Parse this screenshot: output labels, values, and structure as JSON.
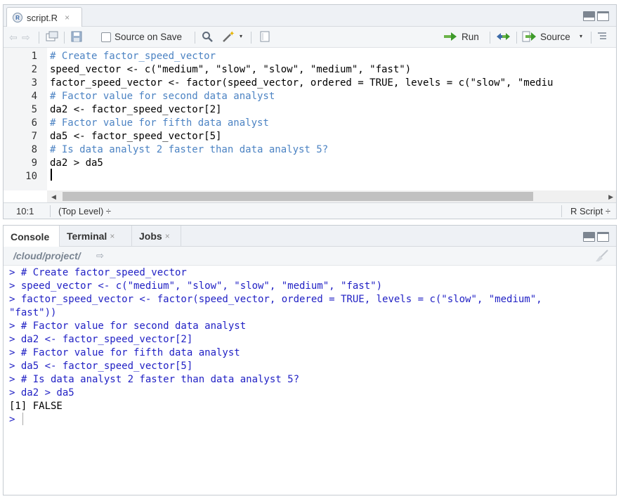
{
  "source_pane": {
    "tab": {
      "label": "script.R",
      "close": "×"
    },
    "toolbar": {
      "source_on_save_label": "Source on Save",
      "run_label": "Run",
      "source_label": "Source"
    },
    "line_numbers": [
      "1",
      "2",
      "3",
      "4",
      "5",
      "6",
      "7",
      "8",
      "9",
      "10"
    ],
    "code_lines": [
      "# Create factor_speed_vector",
      "speed_vector <- c(\"medium\", \"slow\", \"slow\", \"medium\", \"fast\")",
      "factor_speed_vector <- factor(speed_vector, ordered = TRUE, levels = c(\"slow\", \"mediu",
      "# Factor value for second data analyst",
      "da2 <- factor_speed_vector[2]",
      "# Factor value for fifth data analyst",
      "da5 <- factor_speed_vector[5]",
      "# Is data analyst 2 faster than data analyst 5?",
      "da2 > da5",
      ""
    ],
    "status": {
      "position": "10:1",
      "scope": "(Top Level) ÷",
      "file_type": "R Script ÷"
    }
  },
  "console_pane": {
    "tabs": [
      {
        "label": "Console",
        "close": ""
      },
      {
        "label": "Terminal",
        "close": "×"
      },
      {
        "label": "Jobs",
        "close": "×"
      }
    ],
    "path": "/cloud/project/",
    "lines": [
      "> # Create factor_speed_vector",
      "> speed_vector <- c(\"medium\", \"slow\", \"slow\", \"medium\", \"fast\")",
      "> factor_speed_vector <- factor(speed_vector, ordered = TRUE, levels = c(\"slow\", \"medium\",",
      "\"fast\"))",
      "> # Factor value for second data analyst",
      "> da2 <- factor_speed_vector[2]",
      "> # Factor value for fifth data analyst",
      "> da5 <- factor_speed_vector[5]",
      "> # Is data analyst 2 faster than data analyst 5?",
      "> da2 > da5",
      "[1] FALSE",
      ">"
    ]
  }
}
